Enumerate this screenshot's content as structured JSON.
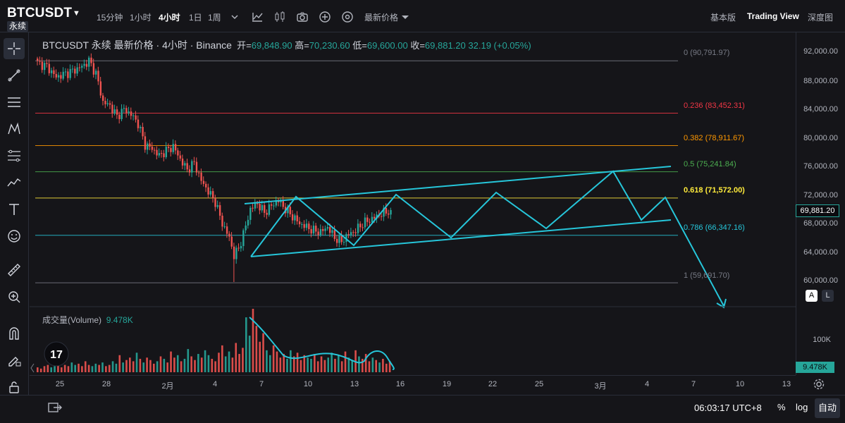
{
  "header": {
    "symbol": "BTCUSDT",
    "perp_badge": "永续",
    "timeframes": [
      "15分钟",
      "1小时",
      "4小时",
      "1日",
      "1周"
    ],
    "active_timeframe": "4小时",
    "price_type": "最新价格",
    "views": [
      "基本版",
      "Trading View",
      "深度图"
    ],
    "active_view": "Trading View"
  },
  "legend": {
    "title": "BTCUSDT 永续 最新价格 · 4小时 · Binance",
    "open_label": "开=",
    "open": "69,848.90",
    "high_label": "高=",
    "high": "70,230.60",
    "low_label": "低=",
    "low": "69,600.00",
    "close_label": "收=",
    "close": "69,881.20",
    "change": "32.19 (+0.05%)"
  },
  "volume_legend": {
    "label": "成交量(Volume)",
    "value": "9.478K"
  },
  "fib_levels": [
    {
      "ratio": "0",
      "price": 90791.97,
      "label": "0 (90,791.97)",
      "color": "#787b86"
    },
    {
      "ratio": "0.236",
      "price": 83452.31,
      "label": "0.236 (83,452.31)",
      "color": "#f23645"
    },
    {
      "ratio": "0.382",
      "price": 78911.67,
      "label": "0.382 (78,911.67)",
      "color": "#ff9800"
    },
    {
      "ratio": "0.5",
      "price": 75241.84,
      "label": "0.5 (75,241.84)",
      "color": "#4caf50"
    },
    {
      "ratio": "0.618",
      "price": 71572.0,
      "label": "0.618 (71,572.00)",
      "color": "#ffeb3b"
    },
    {
      "ratio": "0.786",
      "price": 66347.16,
      "label": "0.786 (66,347.16)",
      "color": "#26c6da"
    },
    {
      "ratio": "1",
      "price": 59691.7,
      "label": "1 (59,691.70)",
      "color": "#787b86"
    }
  ],
  "price_axis": {
    "labels": [
      "92,000.00",
      "88,000.00",
      "84,000.00",
      "80,000.00",
      "76,000.00",
      "72,000.00",
      "68,000.00",
      "64,000.00",
      "60,000.00"
    ],
    "current_price": "69,881.20",
    "volume_tick": "100K",
    "current_volume": "9.478K",
    "mode_a": "A",
    "mode_l": "L"
  },
  "time_axis": {
    "labels": [
      "25",
      "28",
      "2月",
      "4",
      "7",
      "10",
      "13",
      "16",
      "19",
      "22",
      "25",
      "3月",
      "4",
      "7",
      "10",
      "13"
    ]
  },
  "footer": {
    "clock": "06:03:17 UTC+8",
    "percent": "%",
    "log": "log",
    "auto": "自动"
  },
  "colors": {
    "up": "#26a69a",
    "down": "#ef5350",
    "drawing": "#26c6da"
  },
  "chart_data": {
    "type": "candlestick",
    "symbol": "BTCUSDT",
    "interval": "4小时",
    "close_path": [
      [
        0,
        90500
      ],
      [
        4,
        90000
      ],
      [
        8,
        88500
      ],
      [
        12,
        89000
      ],
      [
        16,
        89500
      ],
      [
        20,
        90200
      ],
      [
        22,
        90800
      ],
      [
        25,
        89000
      ],
      [
        28,
        85000
      ],
      [
        31,
        84500
      ],
      [
        34,
        83000
      ],
      [
        37,
        84000
      ],
      [
        40,
        83300
      ],
      [
        43,
        82000
      ],
      [
        46,
        79000
      ],
      [
        49,
        78500
      ],
      [
        52,
        77500
      ],
      [
        55,
        78200
      ],
      [
        58,
        78800
      ],
      [
        61,
        77000
      ],
      [
        64,
        75500
      ],
      [
        67,
        76500
      ],
      [
        70,
        74000
      ],
      [
        73,
        72500
      ],
      [
        76,
        71000
      ],
      [
        79,
        68000
      ],
      [
        82,
        66000
      ],
      [
        84,
        63500
      ],
      [
        86,
        64500
      ],
      [
        88,
        66500
      ],
      [
        91,
        70000
      ],
      [
        94,
        70800
      ],
      [
        97,
        69500
      ],
      [
        100,
        70500
      ],
      [
        103,
        71200
      ],
      [
        106,
        70000
      ],
      [
        109,
        69000
      ],
      [
        112,
        68000
      ],
      [
        115,
        67500
      ],
      [
        118,
        67000
      ],
      [
        121,
        66800
      ],
      [
        124,
        67500
      ],
      [
        127,
        66000
      ],
      [
        130,
        65500
      ],
      [
        133,
        66500
      ],
      [
        136,
        67000
      ],
      [
        139,
        68000
      ],
      [
        142,
        68500
      ],
      [
        145,
        69000
      ],
      [
        148,
        69500
      ],
      [
        151,
        69881
      ]
    ],
    "wick_low": 59800,
    "volume": [
      4,
      3,
      5,
      6,
      4,
      5,
      7,
      4,
      6,
      5,
      8,
      6,
      7,
      5,
      9,
      6,
      5,
      7,
      6,
      8,
      5,
      6,
      9,
      7,
      14,
      8,
      10,
      12,
      9,
      16,
      11,
      8,
      12,
      10,
      7,
      9,
      13,
      11,
      8,
      17,
      12,
      14,
      9,
      11,
      19,
      13,
      10,
      15,
      12,
      18,
      14,
      11,
      9,
      16,
      22,
      13,
      17,
      12,
      24,
      15,
      20,
      45,
      30,
      52,
      38,
      25,
      32,
      18,
      14,
      22,
      17,
      12,
      15,
      11,
      18,
      13,
      16,
      10,
      14,
      12,
      11,
      15,
      9,
      13,
      10,
      12,
      16,
      11,
      14,
      9,
      17,
      12,
      10,
      18,
      13,
      11,
      15,
      9,
      12,
      10,
      8,
      11,
      7,
      9
    ]
  }
}
